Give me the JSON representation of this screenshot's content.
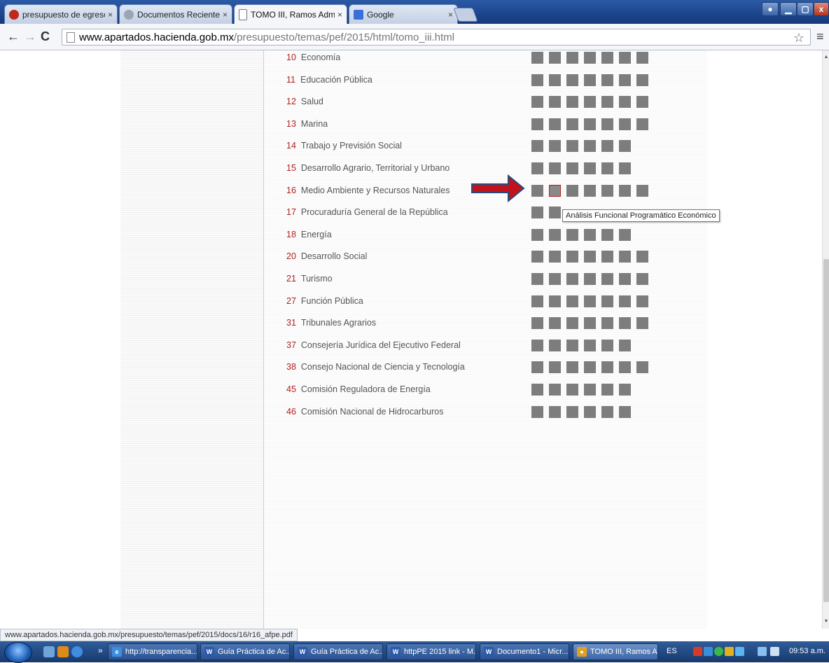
{
  "browser": {
    "tabs": [
      {
        "title": "presupuesto de egresos de",
        "icon": "acrobat-icon"
      },
      {
        "title": "Documentos Recientes PE",
        "icon": "loading-icon"
      },
      {
        "title": "TOMO III, Ramos Adminis",
        "icon": "page-icon"
      },
      {
        "title": "Google",
        "icon": "google-icon"
      }
    ],
    "tab_close": "×",
    "url_host": "www.apartados.hacienda.gob.mx",
    "url_path": "/presupuesto/temas/pef/2015/html/tomo_iii.html",
    "status_url": "www.apartados.hacienda.gob.mx/presupuesto/temas/pef/2015/docs/16/r16_afpe.pdf"
  },
  "ramos": [
    {
      "num": "10",
      "name": "Economía",
      "squares": 7
    },
    {
      "num": "11",
      "name": "Educación Pública",
      "squares": 7
    },
    {
      "num": "12",
      "name": "Salud",
      "squares": 7
    },
    {
      "num": "13",
      "name": "Marina",
      "squares": 7
    },
    {
      "num": "14",
      "name": "Trabajo y Previsión Social",
      "squares": 6
    },
    {
      "num": "15",
      "name": "Desarrollo Agrario, Territorial y Urbano",
      "squares": 6
    },
    {
      "num": "16",
      "name": "Medio Ambiente y Recursos Naturales",
      "squares": 7
    },
    {
      "num": "17",
      "name": "Procuraduría General de la República",
      "squares": 2
    },
    {
      "num": "18",
      "name": "Energía",
      "squares": 6
    },
    {
      "num": "20",
      "name": "Desarrollo Social",
      "squares": 7
    },
    {
      "num": "21",
      "name": "Turismo",
      "squares": 7
    },
    {
      "num": "27",
      "name": "Función Pública",
      "squares": 7
    },
    {
      "num": "31",
      "name": "Tribunales Agrarios",
      "squares": 7
    },
    {
      "num": "37",
      "name": "Consejería Jurídica del Ejecutivo Federal",
      "squares": 6
    },
    {
      "num": "38",
      "name": "Consejo Nacional de Ciencia y Tecnología",
      "squares": 7
    },
    {
      "num": "45",
      "name": "Comisión Reguladora de Energía",
      "squares": 6
    },
    {
      "num": "46",
      "name": "Comisión Nacional de Hidrocarburos",
      "squares": 6
    }
  ],
  "tooltip": "Análisis Funcional Programático Económico",
  "taskbar": {
    "items": [
      {
        "label": "http://transparencia...",
        "icon": "ie-icon"
      },
      {
        "label": "Guía Práctica de Ac...",
        "icon": "word-icon"
      },
      {
        "label": "Guía Práctica de Ac...",
        "icon": "word-icon"
      },
      {
        "label": "httpPE 2015 link - M...",
        "icon": "word-icon"
      },
      {
        "label": "Documento1 - Micr...",
        "icon": "word-icon"
      },
      {
        "label": "TOMO III, Ramos A...",
        "icon": "chrome-icon"
      }
    ],
    "language": "ES",
    "clock": "09:53 a.m."
  },
  "colors": {
    "accent_red": "#b01e1e",
    "square_gray": "#7d7d7d",
    "arrow_red": "#c0141c",
    "arrow_outline": "#2a4a7a"
  }
}
